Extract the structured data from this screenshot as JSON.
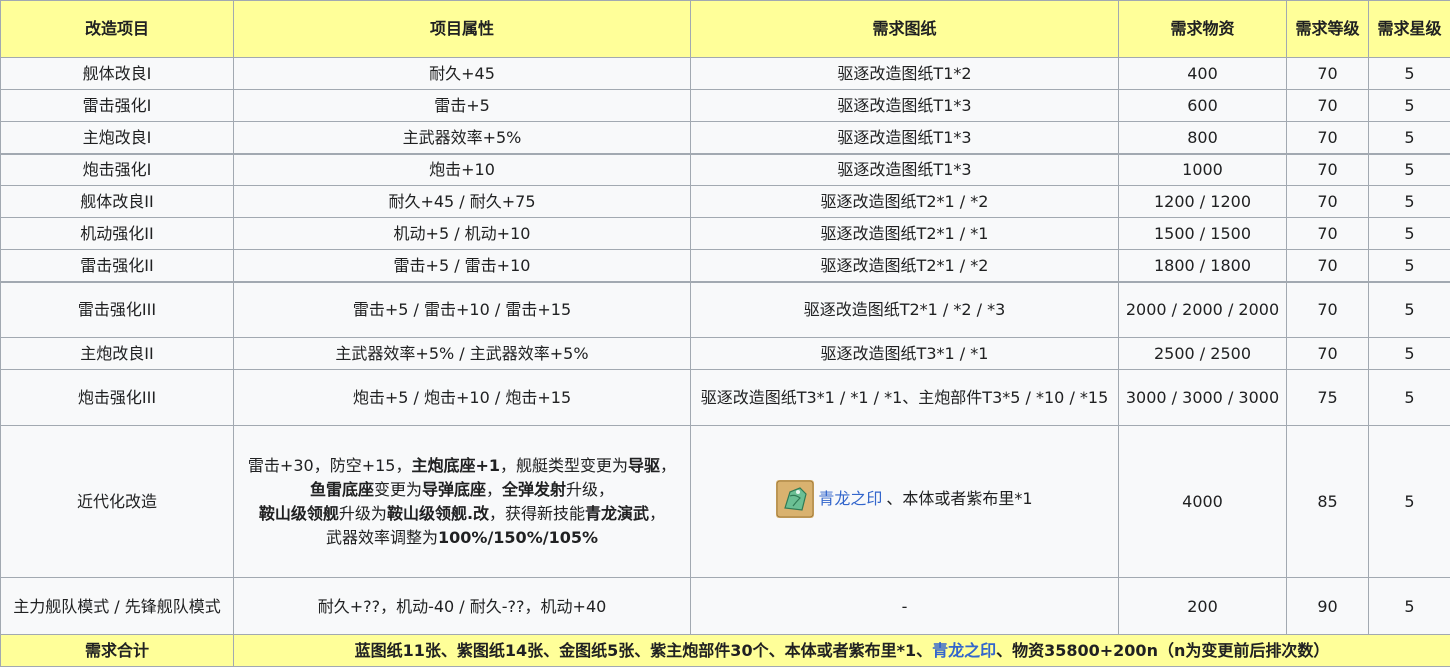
{
  "headers": {
    "project": "改造项目",
    "attribute": "项目属性",
    "blueprint": "需求图纸",
    "materials": "需求物资",
    "level": "需求等级",
    "star": "需求星级"
  },
  "rows": [
    {
      "project": "舰体改良I",
      "attribute": "耐久+45",
      "blueprint": "驱逐改造图纸T1*2",
      "materials": "400",
      "level": "70",
      "star": "5"
    },
    {
      "project": "雷击强化I",
      "attribute": "雷击+5",
      "blueprint": "驱逐改造图纸T1*3",
      "materials": "600",
      "level": "70",
      "star": "5"
    },
    {
      "project": "主炮改良I",
      "attribute": "主武器效率+5%",
      "blueprint": "驱逐改造图纸T1*3",
      "materials": "800",
      "level": "70",
      "star": "5"
    },
    {
      "project": "炮击强化I",
      "attribute": "炮击+10",
      "blueprint": "驱逐改造图纸T1*3",
      "materials": "1000",
      "level": "70",
      "star": "5"
    },
    {
      "project": "舰体改良II",
      "attribute": "耐久+45 / 耐久+75",
      "blueprint": "驱逐改造图纸T2*1 / *2",
      "materials": "1200 / 1200",
      "level": "70",
      "star": "5"
    },
    {
      "project": "机动强化II",
      "attribute": "机动+5 / 机动+10",
      "blueprint": "驱逐改造图纸T2*1 / *1",
      "materials": "1500 / 1500",
      "level": "70",
      "star": "5"
    },
    {
      "project": "雷击强化II",
      "attribute": "雷击+5 / 雷击+10",
      "blueprint": "驱逐改造图纸T2*1 / *2",
      "materials": "1800 / 1800",
      "level": "70",
      "star": "5"
    },
    {
      "project": "雷击强化III",
      "attribute": "雷击+5 / 雷击+10 / 雷击+15",
      "blueprint": "驱逐改造图纸T2*1 / *2 / *3",
      "materials": "2000 / 2000 / 2000",
      "level": "70",
      "star": "5"
    },
    {
      "project": "主炮改良II",
      "attribute": "主武器效率+5% / 主武器效率+5%",
      "blueprint": "驱逐改造图纸T3*1 / *1",
      "materials": "2500 / 2500",
      "level": "70",
      "star": "5"
    },
    {
      "project": "炮击强化III",
      "attribute": "炮击+5 / 炮击+10 / 炮击+15",
      "blueprint": "驱逐改造图纸T3*1 / *1 / *1、主炮部件T3*5 / *10 / *15",
      "materials": "3000 / 3000 / 3000",
      "level": "75",
      "star": "5"
    },
    {
      "project": "近代化改造",
      "attribute_parts": {
        "l1a": "雷击+30，防空+15，",
        "l1b": "主炮底座+1",
        "l1c": "，舰艇类型变更为",
        "l1d": "导驱",
        "l1e": "，",
        "l2a": "鱼雷底座",
        "l2b": "变更为",
        "l2c": "导弹底座",
        "l2d": "，",
        "l2e": "全弹发射",
        "l2f": "升级，",
        "l3a": "鞍山级领舰",
        "l3b": "升级为",
        "l3c": "鞍山级领舰.改",
        "l3d": "，获得新技能",
        "l3e": "青龙演武",
        "l3f": "，",
        "l4a": "武器效率调整为",
        "l4b": "100%/150%/105%"
      },
      "blueprint_link": "青龙之印",
      "blueprint_rest": "、本体或者紫布里*1",
      "seal_icon": "qinglong-seal-icon",
      "materials": "4000",
      "level": "85",
      "star": "5"
    },
    {
      "project": "主力舰队模式 / 先锋舰队模式",
      "attribute": "耐久+??，机动-40 / 耐久-??，机动+40",
      "blueprint": "-",
      "materials": "200",
      "level": "90",
      "star": "5"
    }
  ],
  "footer": {
    "label": "需求合计",
    "text_a": "蓝图纸11张、紫图纸14张、金图纸5张、紫主炮部件30个、本体或者紫布里*1、",
    "link": "青龙之印",
    "text_b": "、物资35800+200n（n为变更前后排次数）"
  },
  "colors": {
    "header_bg": "#ffff99",
    "cell_bg": "#f8f9fa",
    "border": "#a2a9b1",
    "link": "#3366cc"
  }
}
